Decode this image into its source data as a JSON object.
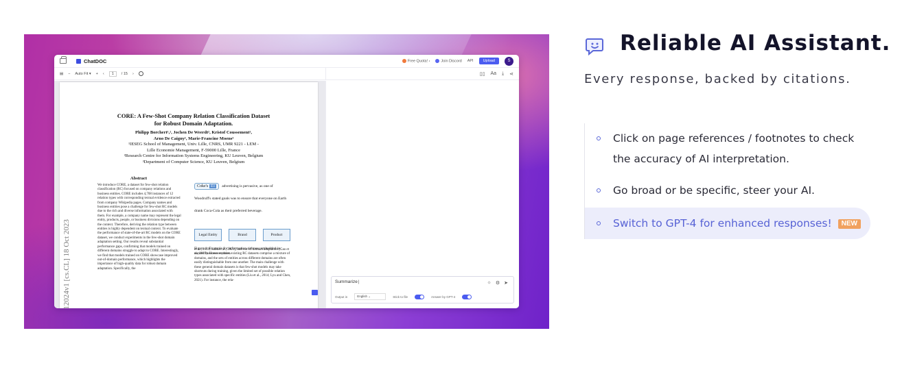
{
  "section": {
    "heading": "Reliable AI Assistant.",
    "subheading": "Every response, backed by citations.",
    "features": [
      {
        "line1": "Click on page references / footnotes to check",
        "line2": "the accuracy of AI interpretation."
      },
      {
        "line1": "Go broad or be specific, steer your AI."
      },
      {
        "line1": "Switch to GPT-4 for enhanced responses!",
        "badge": "NEW"
      }
    ]
  },
  "app": {
    "name": "ChatDOC",
    "topbar": {
      "free_quota": "Free Quota!",
      "join_discord": "Join Discord",
      "api": "API",
      "upload": "Upload",
      "avatar": "S"
    },
    "toolbar": {
      "zoom": "Auto Fit",
      "page_current": "1",
      "page_total": "/ 15"
    },
    "pdf": {
      "arxiv_id": "0.12024v1  [cs.CL]  18 Oct 2023",
      "title_line1": "CORE: A Few-Shot Company Relation Classification Dataset",
      "title_line2": "for Robust Domain Adaptation.",
      "authors_line1": "Philipp Borchert¹,², Jochen De Weerdt², Kristof Coussement¹,",
      "authors_line2": "Arno De Caigny¹, Marie-Francine Moens³",
      "affil_1": "¹IESEG School of Management, Univ. Lille, CNRS, UMR 9221 - LEM -",
      "affil_2": "Lille Economie Management, F-59000 Lille, France",
      "affil_3": "²Research Centre for Information Systems Engineering, KU Leuven, Belgium",
      "affil_4": "³Department of Computer Science, KU Leuven, Belgium",
      "abstract_heading": "Abstract",
      "abstract_text": "We introduce CORE, a dataset for few-shot relation classification (RC) focused on company relations and business entities. CORE includes 4,708 instances of 12 relation types with corresponding textual evidence extracted from company Wikipedia pages. Company names and business entities pose a challenge for few-shot RC models due to the rich and diverse information associated with them. For example, a company name may represent the legal entity, products, people, or business divisions depending on the context. Therefore, deriving the relation type between entities is highly dependent on textual context. To evaluate the performance of state-of-the-art RC models on the CORE dataset, we conduct experiments in the few-shot domain adaptation setting. Our results reveal substantial performance gaps, confirming that models trained on different domains struggle to adapt to CORE. Interestingly, we find that models trained on CORE showcase improved out-of-domain performance, which highlights the importance of high-quality data for robust domain adaptation. Specifically, the",
      "fig_entity": "Coke's",
      "fig_tag": "E1",
      "fig_text": "advertising is pervasive, as one of Woodruff's stated goals was to ensure that everyone on Earth drank Coca-Cola as their preferred beverage.",
      "fig_boxes": [
        "Legal Entity",
        "Brand",
        "Product"
      ],
      "fig_caption": "Figure 1: Example for information richness embedded in named business entities.",
      "col2_text_a": "et al., 2019; Sabo et al., 2021), and out-of-domain adaptation (Gao et al., 2019). However, most existing RC datasets comprise a mixture of domains, and the sets of entities across different domains are often easily distinguishable from one another. The main challenge with these general domain datasets is that few-shot models may take shortcuts during training, given the limited set of possible relation types associated with specific entities (Liu et al., 2014; Lyu and Chen, 2021). For instance, the rela-"
    },
    "chat": {
      "input_value": "Summarize",
      "output_label": "Output in",
      "language": "English",
      "stick_label": "Stick to file",
      "gpt_label": "Answer by GPT-4"
    }
  }
}
